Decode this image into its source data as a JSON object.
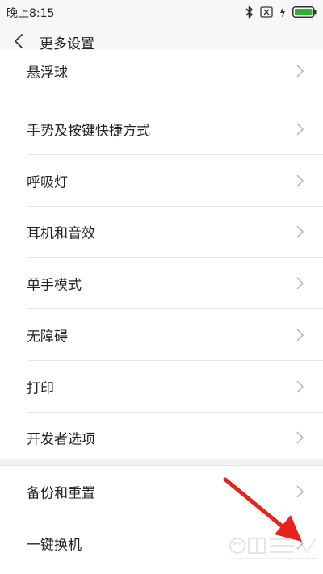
{
  "status_bar": {
    "time": "晚上8:15",
    "icons": [
      "bluetooth-icon",
      "sim-off-icon",
      "charging-icon",
      "battery-icon"
    ],
    "battery_color": "#2fb12f"
  },
  "header": {
    "title": "更多设置",
    "back_icon": "chevron-left-icon"
  },
  "settings": {
    "group1": [
      {
        "label": "悬浮球"
      },
      {
        "label": "手势及按键快捷方式"
      },
      {
        "label": "呼吸灯"
      },
      {
        "label": "耳机和音效"
      },
      {
        "label": "单手模式"
      },
      {
        "label": "无障碍"
      },
      {
        "label": "打印"
      },
      {
        "label": "开发者选项"
      }
    ],
    "group2": [
      {
        "label": "备份和重置"
      },
      {
        "label": "一键换机"
      }
    ]
  },
  "annotation": {
    "arrow_color": "#e8231e"
  }
}
